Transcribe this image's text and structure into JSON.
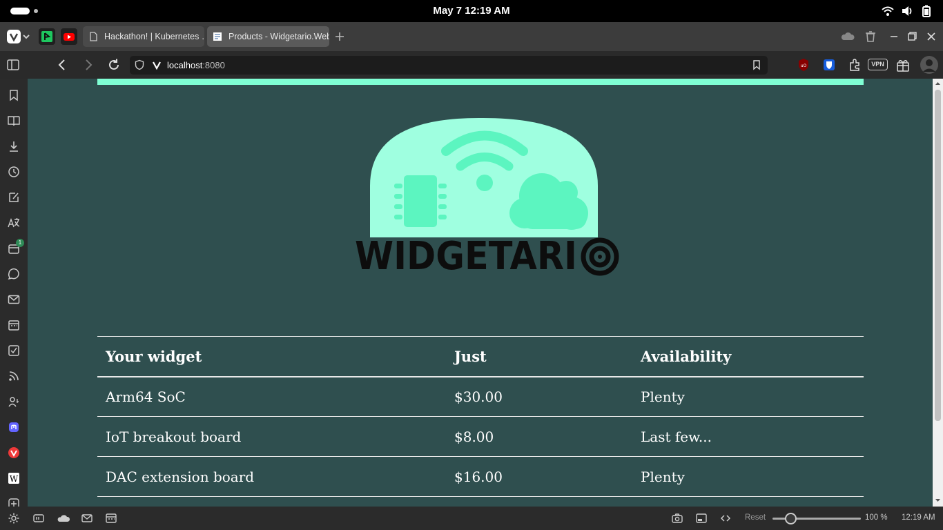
{
  "system": {
    "clock": "May 7  12:19 AM"
  },
  "tabs": [
    {
      "label": "Hackathon! | Kubernetes …",
      "icon": "page-icon"
    },
    {
      "label": "Products - Widgetario.Web",
      "icon": "doc-icon",
      "active": true
    }
  ],
  "navigation": {
    "url_host": "localhost",
    "url_port": ":8080",
    "extensions": {
      "vpn_label": "VPN"
    }
  },
  "sidebar": {
    "badge_count": "1"
  },
  "page": {
    "logo_text": "WIDGETARIO",
    "table": {
      "headers": [
        "Your widget",
        "Just",
        "Availability"
      ],
      "rows": [
        [
          "Arm64 SoC",
          "$30.00",
          "Plenty"
        ],
        [
          "IoT breakout board",
          "$8.00",
          "Last few..."
        ],
        [
          "DAC extension board",
          "$16.00",
          "Plenty"
        ]
      ]
    }
  },
  "status_bar": {
    "reset_label": "Reset",
    "zoom": "100 %",
    "clock": "12:19 AM",
    "zoom_value": 100
  },
  "colors": {
    "page_bg": "#2f4f4f",
    "accent": "#7fffd4",
    "logo_shape": "#9fffe0",
    "logo_glyphs": "#5cf5c0"
  }
}
